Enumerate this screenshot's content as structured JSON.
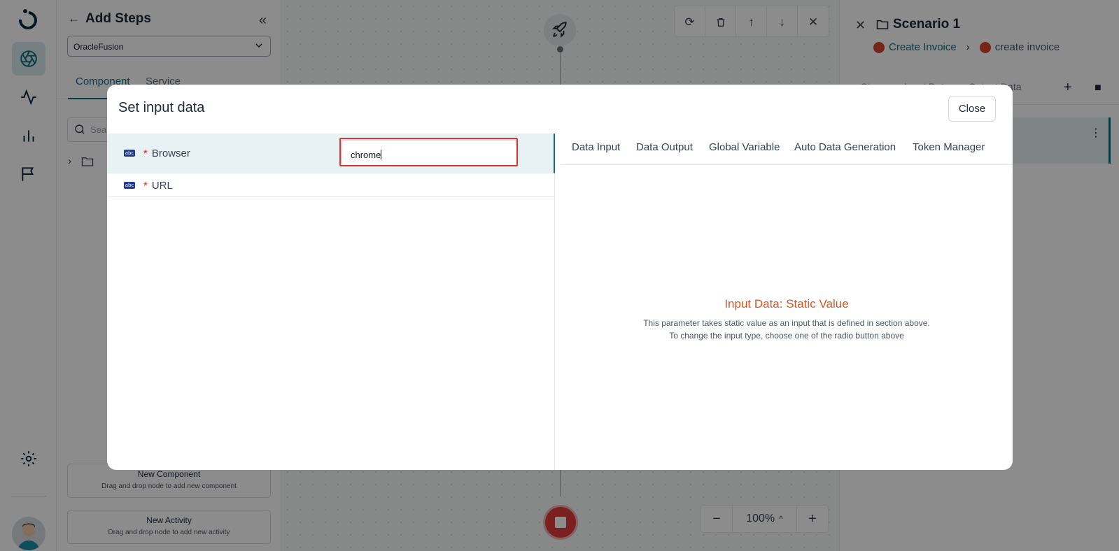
{
  "side_panel": {
    "title": "Add Steps",
    "app_select": "OracleFusion",
    "tabs": [
      "Component",
      "Service"
    ],
    "search_placeholder": "Sea",
    "new_component": {
      "title": "New Component",
      "subtitle": "Drag and drop node to add new component"
    },
    "new_activity": {
      "title": "New Activity",
      "subtitle": "Drag and drop node to add new activity"
    }
  },
  "canvas": {
    "zoom": "100%"
  },
  "right_panel": {
    "title": "Scenario 1",
    "crumb_link": "Create Invoice",
    "crumb_current": "create invoice",
    "tabs": [
      "Steps",
      "Input Data",
      "Output Data"
    ]
  },
  "modal": {
    "title": "Set input data",
    "close_label": "Close",
    "params": [
      {
        "name": "Browser",
        "value": "chrome"
      },
      {
        "name": "URL",
        "value": ""
      }
    ],
    "detail_tabs": [
      "Data Input",
      "Data Output",
      "Global Variable",
      "Auto Data Generation",
      "Token Manager"
    ],
    "heading": "Input Data: Static Value",
    "line1": "This parameter takes static value as an input that is defined in section above.",
    "line2": "To change the input type, choose one of the radio button above"
  },
  "colors": {
    "accent": "#0e6e80",
    "highlight": "#e0342f",
    "heading": "#d4551f"
  }
}
